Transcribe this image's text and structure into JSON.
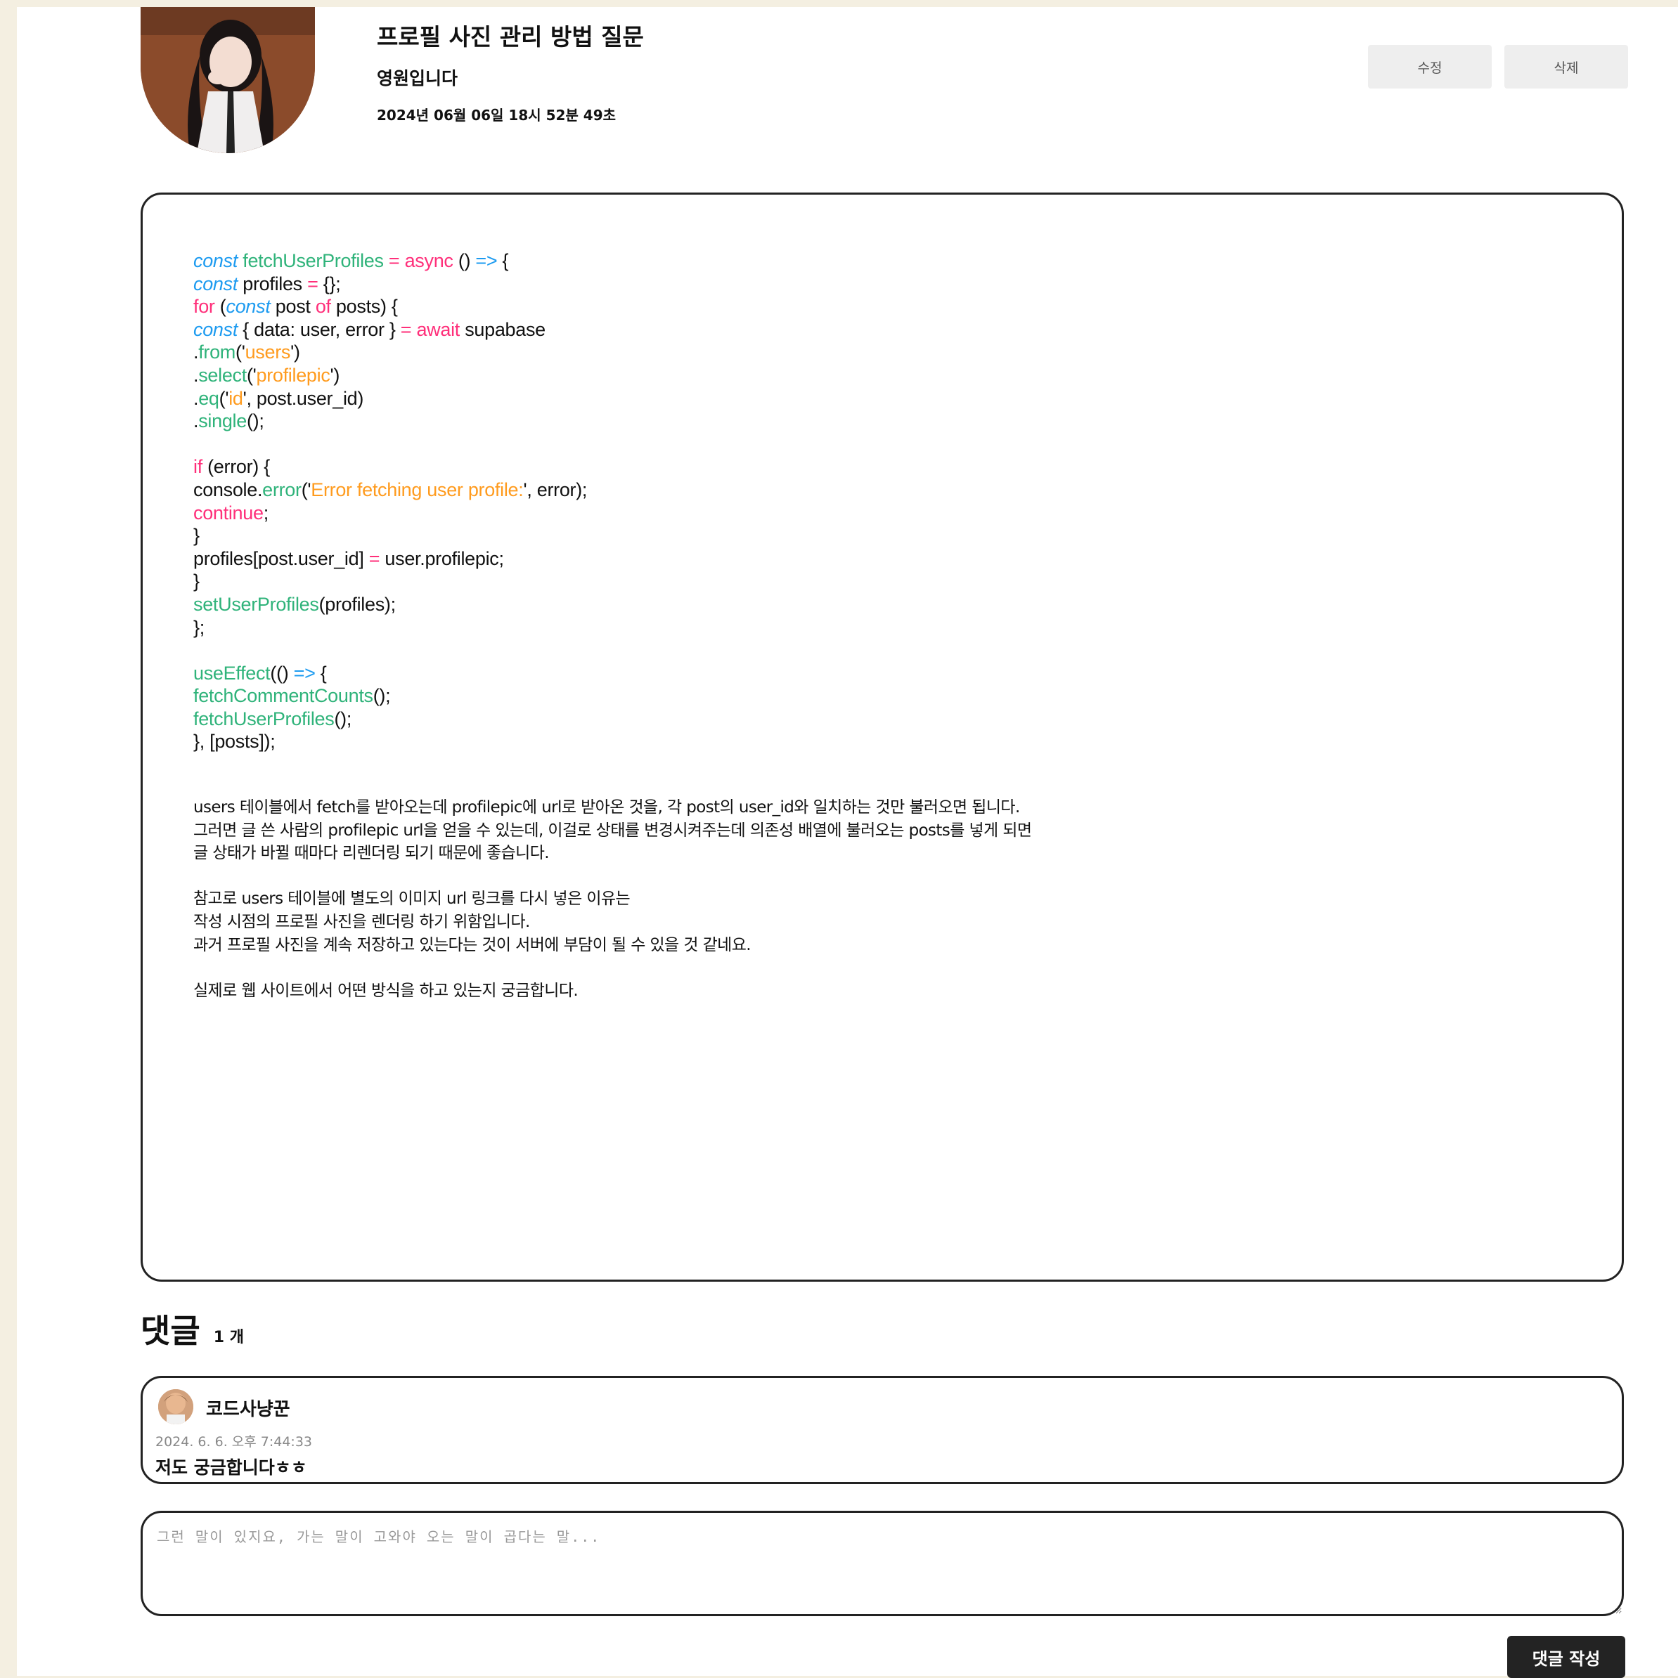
{
  "post": {
    "title": "프로필 사진 관리 방법 질문",
    "author": "영원입니다",
    "date": "2024년 06월 06일 18시 52분 49초",
    "edit_label": "수정",
    "delete_label": "삭제"
  },
  "code_lines": [
    [
      {
        "t": "const",
        "c": "kw"
      },
      {
        "t": " fetchUserProfiles ",
        "c": "fn"
      },
      {
        "t": "=",
        "c": "pk"
      },
      {
        "t": " async",
        "c": "pk"
      },
      {
        "t": " () ",
        "c": ""
      },
      {
        "t": "=>",
        "c": "kw2"
      },
      {
        "t": " {",
        "c": ""
      }
    ],
    [
      {
        "t": "const",
        "c": "kw"
      },
      {
        "t": " profiles ",
        "c": ""
      },
      {
        "t": "=",
        "c": "pk"
      },
      {
        "t": " {};",
        "c": ""
      }
    ],
    [
      {
        "t": "for",
        "c": "pk"
      },
      {
        "t": " (",
        "c": ""
      },
      {
        "t": "const",
        "c": "kw"
      },
      {
        "t": " post ",
        "c": ""
      },
      {
        "t": "of",
        "c": "pk"
      },
      {
        "t": " posts) {",
        "c": ""
      }
    ],
    [
      {
        "t": "const",
        "c": "kw"
      },
      {
        "t": " { data: user, error } ",
        "c": ""
      },
      {
        "t": "=",
        "c": "pk"
      },
      {
        "t": " await",
        "c": "pk"
      },
      {
        "t": " supabase",
        "c": ""
      }
    ],
    [
      {
        "t": ".",
        "c": ""
      },
      {
        "t": "from",
        "c": "fn"
      },
      {
        "t": "('",
        "c": ""
      },
      {
        "t": "users",
        "c": "st"
      },
      {
        "t": "')",
        "c": ""
      }
    ],
    [
      {
        "t": ".",
        "c": ""
      },
      {
        "t": "select",
        "c": "fn"
      },
      {
        "t": "('",
        "c": ""
      },
      {
        "t": "profilepic",
        "c": "st"
      },
      {
        "t": "')",
        "c": ""
      }
    ],
    [
      {
        "t": ".",
        "c": ""
      },
      {
        "t": "eq",
        "c": "fn"
      },
      {
        "t": "('",
        "c": ""
      },
      {
        "t": "id",
        "c": "st"
      },
      {
        "t": "', post.user_id)",
        "c": ""
      }
    ],
    [
      {
        "t": ".",
        "c": ""
      },
      {
        "t": "single",
        "c": "fn"
      },
      {
        "t": "();",
        "c": ""
      }
    ],
    [],
    [
      {
        "t": "if",
        "c": "pk"
      },
      {
        "t": " (error) {",
        "c": ""
      }
    ],
    [
      {
        "t": "console.",
        "c": ""
      },
      {
        "t": "error",
        "c": "fn"
      },
      {
        "t": "('",
        "c": ""
      },
      {
        "t": "Error fetching user profile:",
        "c": "st"
      },
      {
        "t": "', error);",
        "c": ""
      }
    ],
    [
      {
        "t": "continue",
        "c": "pk"
      },
      {
        "t": ";",
        "c": ""
      }
    ],
    [
      {
        "t": "}",
        "c": ""
      }
    ],
    [
      {
        "t": "profiles[post.user_id] ",
        "c": ""
      },
      {
        "t": "=",
        "c": "pk"
      },
      {
        "t": " user.profilepic;",
        "c": ""
      }
    ],
    [
      {
        "t": "}",
        "c": ""
      }
    ],
    [
      {
        "t": "setUserProfiles",
        "c": "fn"
      },
      {
        "t": "(profiles);",
        "c": ""
      }
    ],
    [
      {
        "t": "};",
        "c": ""
      }
    ],
    [],
    [
      {
        "t": "useEffect",
        "c": "fn"
      },
      {
        "t": "(() ",
        "c": ""
      },
      {
        "t": "=>",
        "c": "kw2"
      },
      {
        "t": " {",
        "c": ""
      }
    ],
    [
      {
        "t": "fetchCommentCounts",
        "c": "fn"
      },
      {
        "t": "();",
        "c": ""
      }
    ],
    [
      {
        "t": "fetchUserProfiles",
        "c": "fn"
      },
      {
        "t": "();",
        "c": ""
      }
    ],
    [
      {
        "t": "}, [posts]);",
        "c": ""
      }
    ]
  ],
  "prose_lines": [
    "users 테이블에서 fetch를 받아오는데 profilepic에 url로 받아온 것을, 각 post의 user_id와 일치하는 것만 불러오면 됩니다.",
    "그러면 글 쓴 사람의 profilepic url을 얻을 수 있는데, 이걸로 상태를 변경시켜주는데 의존성 배열에 불러오는 posts를 넣게 되면",
    "글 상태가 바뀔 때마다 리렌더링 되기 때문에 좋습니다.",
    "",
    "참고로 users 테이블에 별도의 이미지 url 링크를 다시 넣은 이유는",
    "작성 시점의 프로필 사진을 렌더링 하기 위함입니다.",
    "과거 프로필 사진을 계속 저장하고 있는다는 것이 서버에 부담이 될 수 있을 것 같네요.",
    "",
    "실제로 웹 사이트에서 어떤 방식을 하고 있는지 궁금합니다."
  ],
  "comments": {
    "heading": "댓글",
    "count": "1 개",
    "items": [
      {
        "name": "코드사냥꾼",
        "date": "2024. 6. 6. 오후 7:44:33",
        "text": "저도 궁금합니다ㅎㅎ"
      }
    ],
    "input_placeholder": "그런 말이 있지요, 가는 말이 고와야 오는 말이 곱다는 말...",
    "submit_label": "댓글 작성"
  },
  "colors": {
    "keyword": "#1d9bf0",
    "operator": "#ff2f7a",
    "function": "#2fb37a",
    "string": "#ff9b1e",
    "background": "#f4efe1"
  },
  "icons": {
    "author_avatar": "profile-photo",
    "comment_avatar": "commenter-photo"
  }
}
